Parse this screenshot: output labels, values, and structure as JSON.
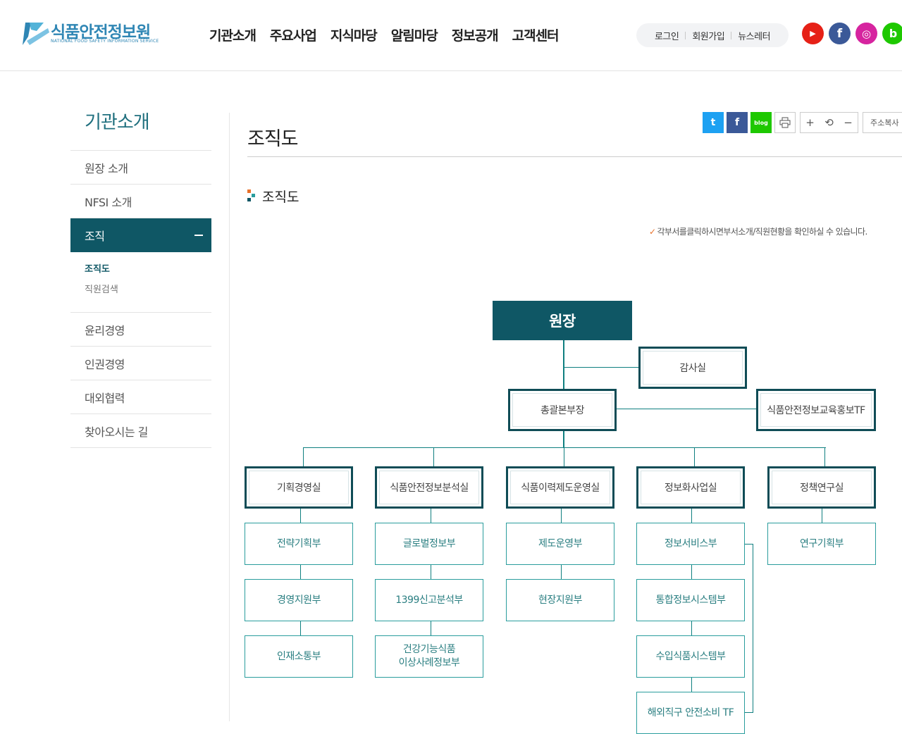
{
  "header": {
    "logo_name": "식품안전정보원",
    "logo_sub": "NATIONAL FOOD SAFETY INFORMATION SERVICE",
    "nav": [
      "기관소개",
      "주요사업",
      "지식마당",
      "알림마당",
      "정보공개",
      "고객센터"
    ],
    "util": {
      "login": "로그인",
      "join": "회원가입",
      "newsletter": "뉴스레터"
    },
    "sns": {
      "youtube": "▶",
      "facebook": "f",
      "instagram": "◎",
      "blog": "b"
    }
  },
  "colors": {
    "brand": "#0f5765",
    "accent": "#2f86b4",
    "dept_border": "#2a9d9d",
    "check": "#e8712b"
  },
  "sidebar": {
    "title": "기관소개",
    "items_before": [
      "원장 소개",
      "NFSI 소개"
    ],
    "active": "조직",
    "sub": [
      "조직도",
      "직원검색"
    ],
    "items_after": [
      "윤리경영",
      "인권경영",
      "대외협력",
      "찾아오시는 길"
    ]
  },
  "content": {
    "page_title": "조직도",
    "section_title": "조직도",
    "notice": "각부서를클릭하시면부서소개/직원현황을 확인하실 수 있습니다.",
    "tools": {
      "twitter": "t",
      "facebook": "f",
      "blog": "blog",
      "zoom_in": "+",
      "reset": "⟲",
      "zoom_out": "−",
      "copy_url": "주소복사"
    }
  },
  "org": {
    "director": "원장",
    "audit": "감사실",
    "general": "총괄본부장",
    "tf": "식품안전정보교육홍보TF",
    "offices": [
      {
        "name": "기획경영실",
        "depts": [
          "전략기획부",
          "경영지원부",
          "인재소통부"
        ]
      },
      {
        "name": "식품안전정보분석실",
        "depts": [
          "글로벌정보부",
          "1399신고분석부",
          "건강기능식품\n이상사례정보부"
        ]
      },
      {
        "name": "식품이력제도운영실",
        "depts": [
          "제도운영부",
          "현장지원부"
        ]
      },
      {
        "name": "정보화사업실",
        "depts": [
          "정보서비스부",
          "통합정보시스템부",
          "수입식품시스템부",
          "해외직구 안전소비 TF"
        ]
      },
      {
        "name": "정책연구실",
        "depts": [
          "연구기획부"
        ]
      }
    ]
  }
}
